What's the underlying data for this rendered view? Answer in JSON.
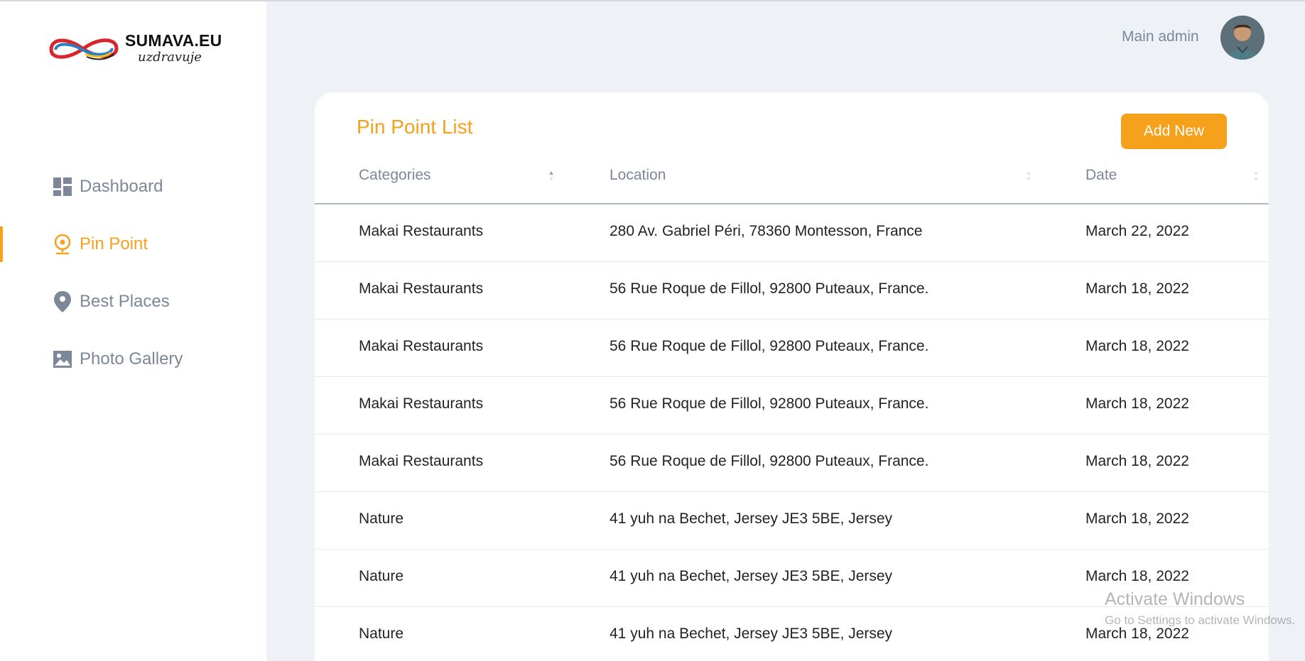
{
  "brand": {
    "title": "SUMAVA.EU",
    "subtitle": "uzdravuje"
  },
  "sidebar": {
    "items": [
      {
        "label": "Dashboard",
        "icon": "dashboard-icon",
        "active": false
      },
      {
        "label": "Pin Point",
        "icon": "location-pin-icon",
        "active": true
      },
      {
        "label": "Best Places",
        "icon": "map-marker-icon",
        "active": false
      },
      {
        "label": "Photo Gallery",
        "icon": "image-icon",
        "active": false
      }
    ]
  },
  "header": {
    "user_name": "Main admin"
  },
  "main": {
    "title": "Pin Point List",
    "add_button": "Add New",
    "table": {
      "columns": [
        "Categories",
        "Location",
        "Date"
      ],
      "rows": [
        [
          "Makai Restaurants",
          "280 Av. Gabriel Péri, 78360 Montesson, France",
          "March 22, 2022"
        ],
        [
          "Makai Restaurants",
          "56 Rue Roque de Fillol, 92800 Puteaux, France.",
          "March 18, 2022"
        ],
        [
          "Makai Restaurants",
          "56 Rue Roque de Fillol, 92800 Puteaux, France.",
          "March 18, 2022"
        ],
        [
          "Makai Restaurants",
          "56 Rue Roque de Fillol, 92800 Puteaux, France.",
          "March 18, 2022"
        ],
        [
          "Makai Restaurants",
          "56 Rue Roque de Fillol, 92800 Puteaux, France.",
          "March 18, 2022"
        ],
        [
          "Nature",
          "41 yuh na Bechet, Jersey JE3 5BE, Jersey",
          "March 18, 2022"
        ],
        [
          "Nature",
          "41 yuh na Bechet, Jersey JE3 5BE, Jersey",
          "March 18, 2022"
        ],
        [
          "Nature",
          "41 yuh na Bechet, Jersey JE3 5BE, Jersey",
          "March 18, 2022"
        ]
      ]
    }
  },
  "watermark": {
    "line1": "Activate Windows",
    "line2": "Go to Settings to activate Windows."
  },
  "colors": {
    "accent": "#f5a11c",
    "muted": "#7d879a",
    "background": "#eef1f5"
  }
}
